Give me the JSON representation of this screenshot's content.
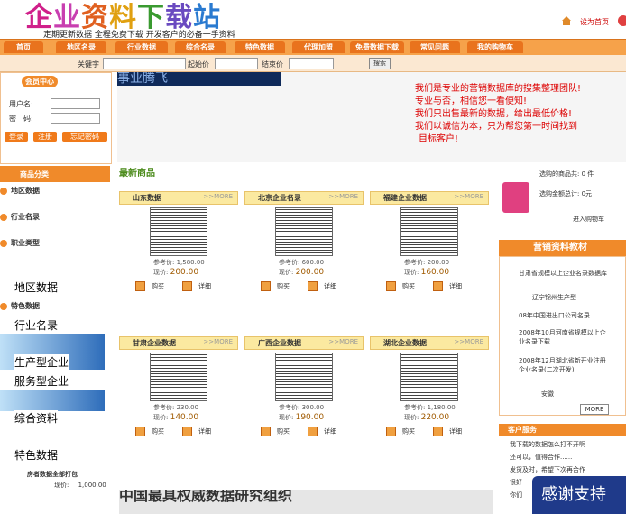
{
  "header": {
    "logo_text": "企业资料下载站",
    "tagline": "定期更新数据 全程免费下载 开发客户的必备一手资料",
    "set_home": "设为首页"
  },
  "nav": {
    "items": [
      "首页",
      "地区名录",
      "行业数据",
      "综合名录",
      "特色数据",
      "代理加盟",
      "免费数据下载",
      "常见问题",
      "我的购物车"
    ]
  },
  "search": {
    "keyword_label": "关键字",
    "start_price_label": "起始价",
    "end_price_label": "结束价",
    "button": "搜索"
  },
  "member": {
    "title": "会员中心",
    "user_label": "用户名:",
    "password_label": "密　码:",
    "login": "登录",
    "register": "注册",
    "forgot": "忘记密码"
  },
  "banner": {
    "dark_text": "事业腾飞",
    "lines": [
      "我们是专业的营销数据库的搜集整理团队!",
      "专业与否，相信您一看便知!",
      "我们只出售最新的数据，给出最低价格!",
      "我们以诚信为本，只为帮您第一时间找到",
      "目标客户!"
    ]
  },
  "left_nav": {
    "title": "商品分类",
    "items": [
      "地区数据",
      "行业名录",
      "职业类型",
      "特色数据"
    ],
    "overlay": [
      "地区数据",
      "行业名录",
      "生产型企业",
      "服务型企业",
      "综合资料",
      "特色数据"
    ],
    "bottom_item": "房者数据全部打包",
    "bottom_price_label": "现价:",
    "bottom_price": "1,000.00"
  },
  "latest": {
    "heading": "最新商品",
    "more": ">>MORE",
    "ref_label": "参考价:",
    "now_label": "现价:",
    "buy": "购买",
    "detail": "详细",
    "products": [
      {
        "title": "山东数据",
        "ref": "1,580.00",
        "price": "200.00"
      },
      {
        "title": "北京企业名录",
        "ref": "600.00",
        "price": "200.00"
      },
      {
        "title": "福建企业数据",
        "ref": "200.00",
        "price": "160.00"
      },
      {
        "title": "甘肃企业数据",
        "ref": "230.00",
        "price": "140.00"
      },
      {
        "title": "广西企业数据",
        "ref": "300.00",
        "price": "190.00"
      },
      {
        "title": "湖北企业数据",
        "ref": "1,180.00",
        "price": "220.00"
      }
    ]
  },
  "right": {
    "cart_items": "选购的商品共: 0 件",
    "cart_total": "选购金额总计: 0元",
    "go_cart": "进入购物车",
    "sales_title": "营销资料教材",
    "sales_items": [
      "甘肃省规模以上企业名录数据库",
      "辽宁锦州生产型",
      "08年中国进出口公司名录",
      "2008年10月河南省规模以上企业名录下载",
      "2008年12月湖北省新开业注册企业名录(二次开发)",
      "安徽"
    ],
    "more": "MORE",
    "client_title": "客户服务",
    "client_items": [
      "我下载的数据怎么打不开啊",
      "还可以，值得合作......",
      "发货及时，希望下次再合作",
      "很好",
      "你们"
    ],
    "thanks": "感谢支持"
  },
  "bottom_banner": "中国最具权威数据研究组织"
}
